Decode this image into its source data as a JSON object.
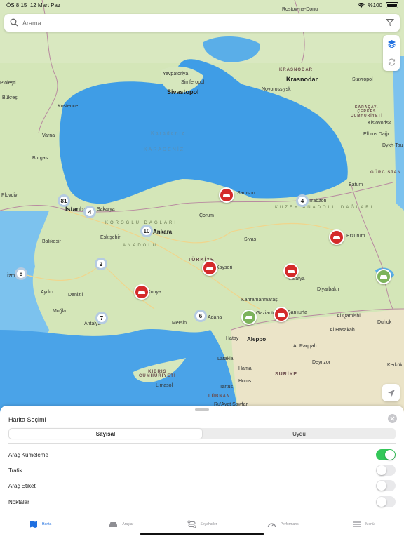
{
  "status": {
    "time": "ÖS 8:15",
    "date": "12 Mart Paz",
    "battery": "%100"
  },
  "search": {
    "placeholder": "Arama"
  },
  "map": {
    "countries": [
      {
        "name": "TÜRKİYE"
      },
      {
        "name": "SURİYE"
      },
      {
        "name": "GÜRCİSTAN"
      },
      {
        "name": "KIBRIS\nCUMHURİYETİ"
      },
      {
        "name": "LÜBNAN"
      }
    ],
    "seas": [
      {
        "name": "Karadeniz"
      },
      {
        "name": "KARADENİZ"
      }
    ],
    "cities": [
      {
        "name": "Rostov-na-Donu"
      },
      {
        "name": "Krasnodar"
      },
      {
        "name": "Novorossiysk"
      },
      {
        "name": "Sivastopol"
      },
      {
        "name": "Simferopol"
      },
      {
        "name": "Yevpatoriya"
      },
      {
        "name": "Stavropol"
      },
      {
        "name": "Kislovodsk"
      },
      {
        "name": "Elbrus Dağı"
      },
      {
        "name": "Dykh-Tau"
      },
      {
        "name": "Batum"
      },
      {
        "name": "Trabzon"
      },
      {
        "name": "Samsun"
      },
      {
        "name": "İstanbul"
      },
      {
        "name": "Sakarya"
      },
      {
        "name": "Ankara"
      },
      {
        "name": "Eskişehir"
      },
      {
        "name": "Balıkesir"
      },
      {
        "name": "İzmir"
      },
      {
        "name": "Aydın"
      },
      {
        "name": "Denizli"
      },
      {
        "name": "Muğla"
      },
      {
        "name": "Antalya"
      },
      {
        "name": "Konya"
      },
      {
        "name": "Mersin"
      },
      {
        "name": "Adana"
      },
      {
        "name": "Hatay"
      },
      {
        "name": "Aleppo"
      },
      {
        "name": "Kayseri"
      },
      {
        "name": "Sivas"
      },
      {
        "name": "Malatya"
      },
      {
        "name": "Diyarbakır"
      },
      {
        "name": "Şanlıurfa"
      },
      {
        "name": "Gaziantep"
      },
      {
        "name": "Kahramanmaraş"
      },
      {
        "name": "Erzurum"
      },
      {
        "name": "Çorum"
      },
      {
        "name": "Burgas"
      },
      {
        "name": "Varna"
      },
      {
        "name": "Kostence"
      },
      {
        "name": "Bükreş"
      },
      {
        "name": "Ploieşti"
      },
      {
        "name": "Plovdiv"
      },
      {
        "name": "Al Qamishli"
      },
      {
        "name": "Al Hasakah"
      },
      {
        "name": "Deyrizor"
      },
      {
        "name": "Ar Raqqah"
      },
      {
        "name": "Hama"
      },
      {
        "name": "Homs"
      },
      {
        "name": "Latakia"
      },
      {
        "name": "Tartus"
      },
      {
        "name": "Limasol"
      },
      {
        "name": "Duhok"
      },
      {
        "name": "Kerkük"
      },
      {
        "name": "Ru'Ayat Sawfar"
      },
      {
        "name": "KRASNODAR"
      },
      {
        "name": "KARAÇAY-\nÇERKES\nCUMHURİYETİ"
      }
    ],
    "mountains": [
      "KUZEY ANADOLU DAĞLARI",
      "KÖROĞLU DAĞLARI",
      "ANADOLU"
    ],
    "clusters": [
      {
        "count": "81"
      },
      {
        "count": "4"
      },
      {
        "count": "10"
      },
      {
        "count": "2"
      },
      {
        "count": "8"
      },
      {
        "count": "7"
      },
      {
        "count": "6"
      },
      {
        "count": "4"
      }
    ],
    "vehicle_colors": {
      "red": "#d42a2a",
      "green": "#7cb35b"
    }
  },
  "sheet": {
    "title": "Harita Seçimi",
    "segments": [
      {
        "label": "Sayısal",
        "active": true
      },
      {
        "label": "Uydu",
        "active": false
      }
    ],
    "options": [
      {
        "label": "Araç Kümeleme",
        "on": true
      },
      {
        "label": "Trafik",
        "on": false
      },
      {
        "label": "Araç Etiketi",
        "on": false
      },
      {
        "label": "Noktalar",
        "on": false
      }
    ]
  },
  "tabs": [
    {
      "label": "Harita",
      "icon": "map-icon",
      "active": true
    },
    {
      "label": "Araçlar",
      "icon": "car-icon",
      "active": false
    },
    {
      "label": "Seyahatler",
      "icon": "route-icon",
      "active": false
    },
    {
      "label": "Performans",
      "icon": "gauge-icon",
      "active": false
    },
    {
      "label": "Menü",
      "icon": "menu-icon",
      "active": false
    }
  ],
  "colors": {
    "accent": "#1f6fe0",
    "toggle_on": "#34c759",
    "sea": "#4aa3e8",
    "land": "#cfe3b4"
  }
}
